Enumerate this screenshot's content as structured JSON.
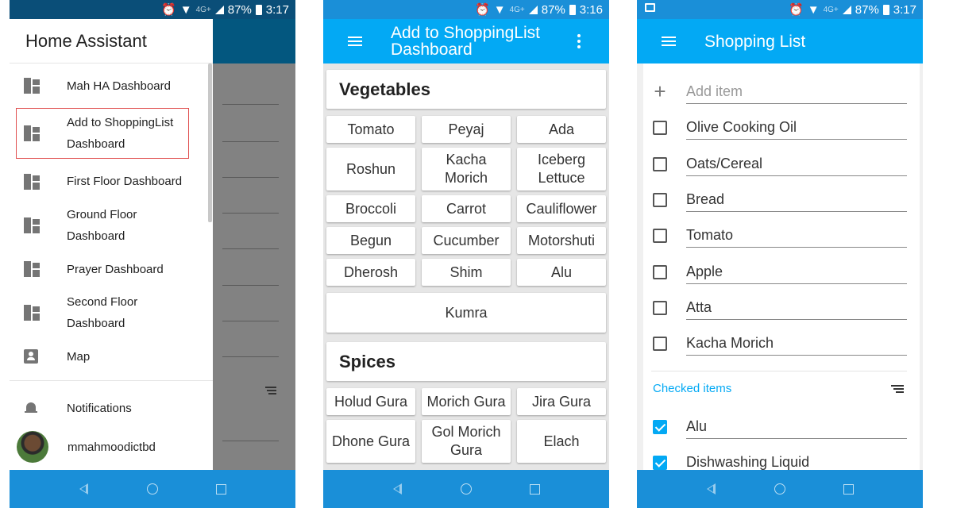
{
  "status_bars": [
    {
      "battery": "87%",
      "time": "3:17",
      "network": "4G+"
    },
    {
      "battery": "87%",
      "time": "3:16",
      "network": "4G+"
    },
    {
      "battery": "87%",
      "time": "3:17",
      "network": "4G+"
    }
  ],
  "drawer": {
    "title": "Home Assistant",
    "items": [
      {
        "label": "Mah HA Dashboard",
        "icon": "dashboard-icon"
      },
      {
        "label": "Add to ShoppingList Dashboard",
        "icon": "dashboard-icon"
      },
      {
        "label": "First Floor Dashboard",
        "icon": "dashboard-icon"
      },
      {
        "label": "Ground Floor Dashboard",
        "icon": "dashboard-icon"
      },
      {
        "label": "Prayer Dashboard",
        "icon": "dashboard-icon"
      },
      {
        "label": "Second Floor Dashboard",
        "icon": "dashboard-icon"
      },
      {
        "label": "Map",
        "icon": "map-icon"
      }
    ],
    "notifications_label": "Notifications",
    "user_name": "mmahmoodictbd"
  },
  "dashboard": {
    "title": "Add to ShoppingList Dashboard",
    "vegetables_title": "Vegetables",
    "vegetables": [
      "Tomato",
      "Peyaj",
      "Ada",
      "Roshun",
      "Kacha Morich",
      "Iceberg Lettuce",
      "Broccoli",
      "Carrot",
      "Cauliflower",
      "Begun",
      "Cucumber",
      "Motorshuti",
      "Dherosh",
      "Shim",
      "Alu",
      "Kumra"
    ],
    "spices_title": "Spices",
    "spices": [
      "Holud Gura",
      "Morich Gura",
      "Jira Gura",
      "Dhone Gura",
      "Gol Morich Gura",
      "Elach"
    ]
  },
  "shopping_list": {
    "title": "Shopping List",
    "add_placeholder": "Add item",
    "items": [
      "Olive Cooking Oil",
      "Oats/Cereal",
      "Bread",
      "Tomato",
      "Apple",
      "Atta",
      "Kacha Morich"
    ],
    "checked_header": "Checked items",
    "checked_items": [
      "Alu",
      "Dishwashing Liquid"
    ]
  },
  "colors": {
    "primary": "#03a9f4",
    "status_bar": "#1a8fd8",
    "drawer_header_dark": "#03577f"
  }
}
